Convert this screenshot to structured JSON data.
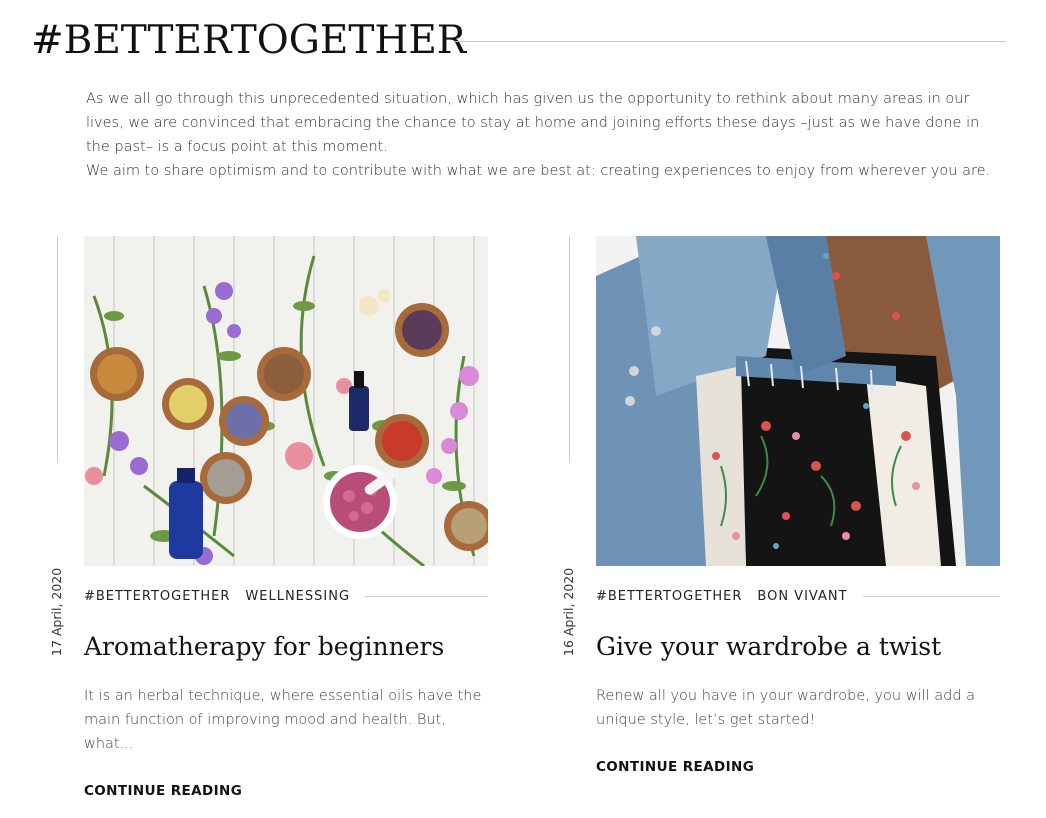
{
  "section": {
    "title": "#BETTERTOGETHER",
    "intro_p1": "As we all go through this unprecedented situation, which has given us the opportunity to rethink about many areas in our lives, we are convinced that embracing the chance to stay at home and joining efforts these days –just as we have done in the past– is a focus point at this moment.",
    "intro_p2": "We aim to share optimism and to contribute with what we are best at: creating experiences to enjoy from wherever you are."
  },
  "posts": [
    {
      "date": "17 April, 2020",
      "image_subject": "herbs-and-essential-oils-image",
      "tags": [
        "#BETTERTOGETHER",
        "WELLNESSING"
      ],
      "title": "Aromatherapy for beginners",
      "excerpt": "It is an herbal technique, where essential oils have the main function of improving mood and health. But, what...",
      "cta": "CONTINUE READING"
    },
    {
      "date": "16 April, 2020",
      "image_subject": "embroidered-denim-jacket-image",
      "tags": [
        "#BETTERTOGETHER",
        "BON VIVANT"
      ],
      "title": "Give your wardrobe a twist",
      "excerpt": "Renew all you have in your wardrobe, you will add a unique style, let’s get started!",
      "cta": "CONTINUE READING"
    }
  ],
  "colors": {
    "rule": "#cfcfcf",
    "text": "#222222",
    "denim": "#6f93b4",
    "wood": "#a86a3a"
  }
}
